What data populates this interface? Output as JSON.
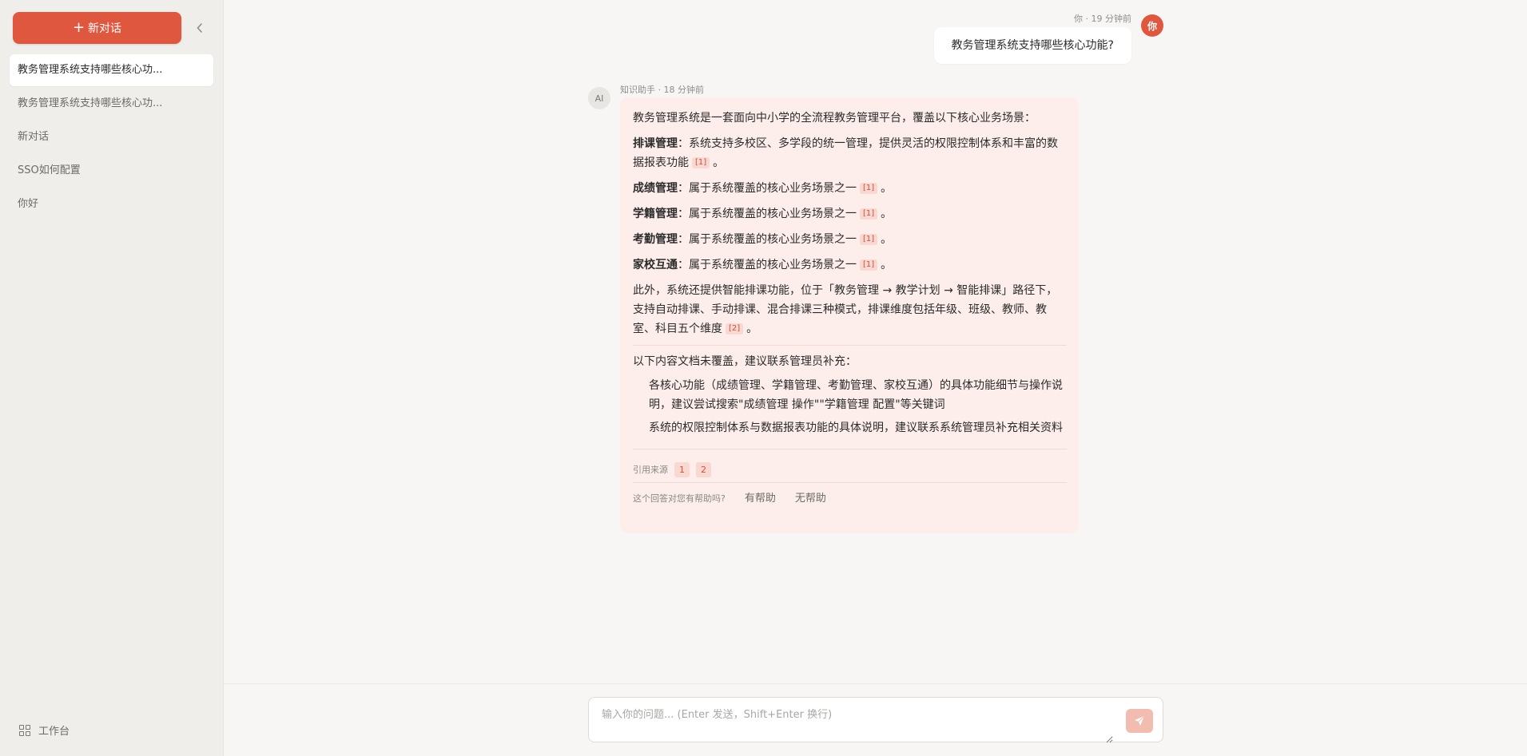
{
  "sidebar": {
    "new_chat_label": "新对话",
    "collapse_icon": "chevron-left-icon",
    "conversations": [
      {
        "label": "教务管理系统支持哪些核心功...",
        "active": true
      },
      {
        "label": "教务管理系统支持哪些核心功...",
        "active": false
      },
      {
        "label": "新对话",
        "active": false
      },
      {
        "label": "SSO如何配置",
        "active": false
      },
      {
        "label": "你好",
        "active": false
      }
    ],
    "workspace_label": "工作台"
  },
  "chat": {
    "user_message": {
      "meta": "你 · 19 分钟前",
      "avatar": "你",
      "text": "教务管理系统支持哪些核心功能?"
    },
    "assistant_message": {
      "avatar": "AI",
      "meta": "知识助手 · 18 分钟前",
      "intro": "教务管理系统是一套面向中小学的全流程教务管理平台，覆盖以下核心业务场景：",
      "items": [
        {
          "title": "排课管理",
          "text": "：系统支持多校区、多学段的统一管理，提供灵活的权限控制体系和丰富的数据报表功能",
          "cite": "[1]",
          "end": "。"
        },
        {
          "title": "成绩管理",
          "text": "：属于系统覆盖的核心业务场景之一",
          "cite": "[1]",
          "end": "。"
        },
        {
          "title": "学籍管理",
          "text": "：属于系统覆盖的核心业务场景之一",
          "cite": "[1]",
          "end": "。"
        },
        {
          "title": "考勤管理",
          "text": "：属于系统覆盖的核心业务场景之一",
          "cite": "[1]",
          "end": "。"
        },
        {
          "title": "家校互通",
          "text": "：属于系统覆盖的核心业务场景之一",
          "cite": "[1]",
          "end": "。"
        }
      ],
      "extra": {
        "text": "此外，系统还提供智能排课功能，位于「教务管理 → 教学计划 → 智能排课」路径下，支持自动排课、手动排课、混合排课三种模式，排课维度包括年级、班级、教师、教室、科目五个维度",
        "cite": "[2]",
        "end": "。"
      },
      "uncovered_title": "以下内容文档未覆盖，建议联系管理员补充：",
      "uncovered_items": [
        "各核心功能（成绩管理、学籍管理、考勤管理、家校互通）的具体功能细节与操作说明，建议尝试搜索\"成绩管理 操作\"\"学籍管理 配置\"等关键词",
        "系统的权限控制体系与数据报表功能的具体说明，建议联系系统管理员补充相关资料"
      ],
      "sources_label": "引用来源",
      "sources": [
        "1",
        "2"
      ],
      "feedback_question": "这个回答对您有帮助吗?",
      "helpful_label": "有帮助",
      "not_helpful_label": "无帮助"
    }
  },
  "input": {
    "placeholder": "输入你的问题... (Enter 发送，Shift+Enter 换行)",
    "value": "",
    "send_icon": "send-icon"
  },
  "colors": {
    "accent": "#e0573f",
    "assistant_bubble": "#fdeeeb",
    "sidebar_bg": "#efeeeb",
    "main_bg": "#f7f6f4"
  }
}
